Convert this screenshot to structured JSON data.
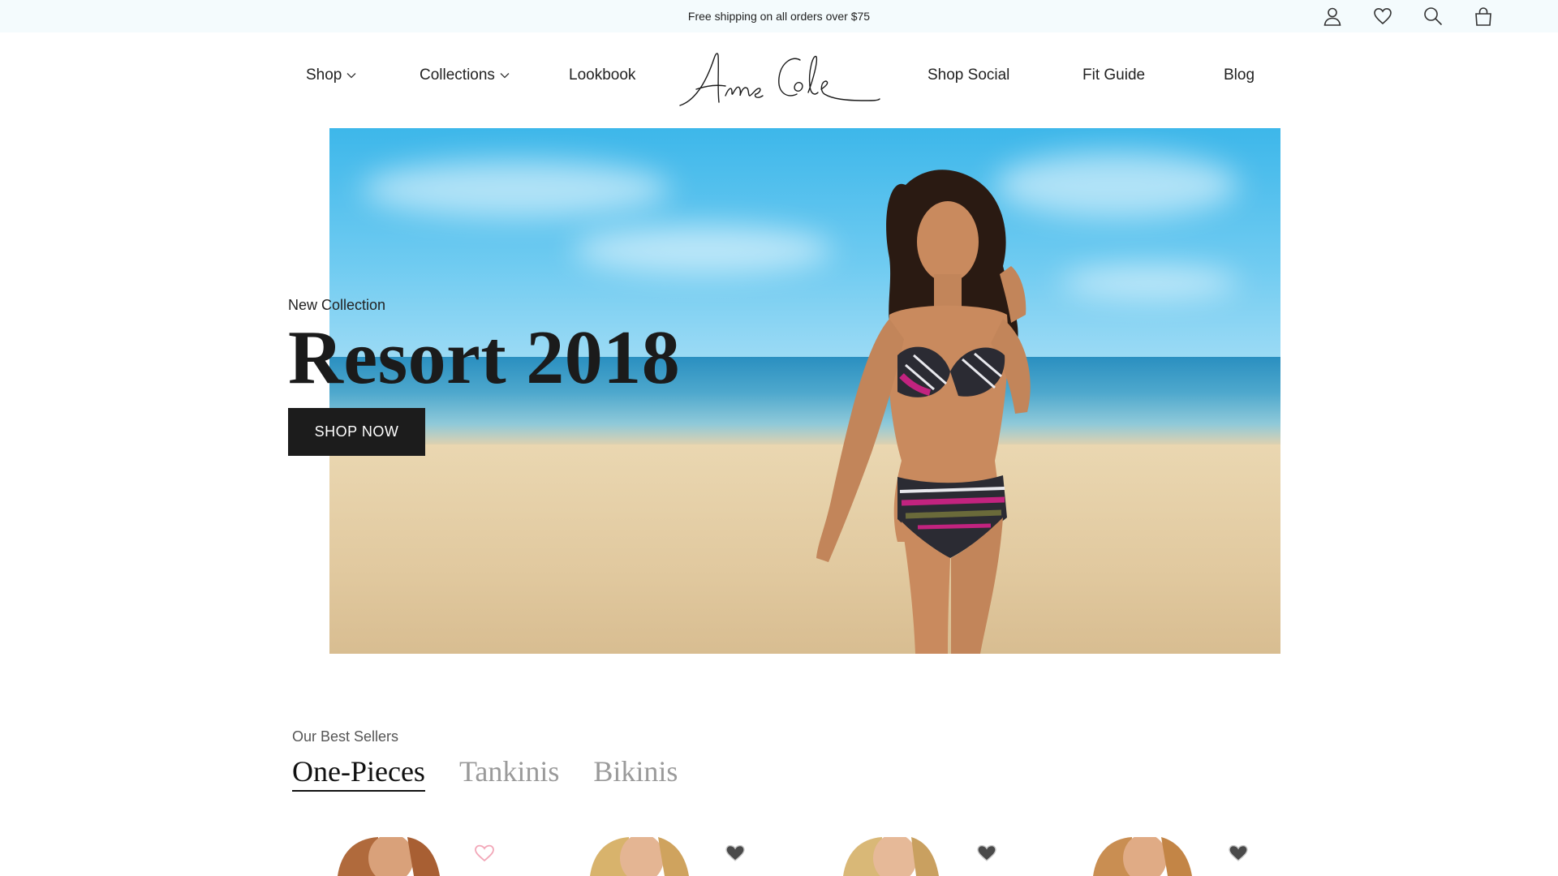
{
  "announcement": {
    "text": "Free shipping on all orders over $75"
  },
  "utility_icons": [
    "user-icon",
    "heart-icon",
    "search-icon",
    "bag-icon"
  ],
  "nav": {
    "shop": "Shop",
    "collections": "Collections",
    "lookbook": "Lookbook",
    "shop_social": "Shop Social",
    "fit_guide": "Fit Guide",
    "blog": "Blog"
  },
  "brand": {
    "logo_text": "Anne Cole"
  },
  "hero": {
    "eyebrow": "New Collection",
    "headline": "Resort 2018",
    "cta": "SHOP NOW"
  },
  "best_sellers": {
    "label": "Our Best Sellers",
    "tabs": [
      "One-Pieces",
      "Tankinis",
      "Bikinis"
    ],
    "active_tab": "One-Pieces",
    "products": [
      {
        "favorite_icon": "heart-outline-icon",
        "favorited": false
      },
      {
        "favorite_icon": "heart-filled-icon",
        "favorited": true
      },
      {
        "favorite_icon": "heart-filled-icon",
        "favorited": true
      },
      {
        "favorite_icon": "heart-filled-icon",
        "favorited": true
      }
    ]
  },
  "colors": {
    "announcement_bg": "#f4fbfd",
    "cta_bg": "#1c1c1c",
    "heart_outline": "#f2a7b8",
    "heart_filled": "#4a4a4a"
  }
}
